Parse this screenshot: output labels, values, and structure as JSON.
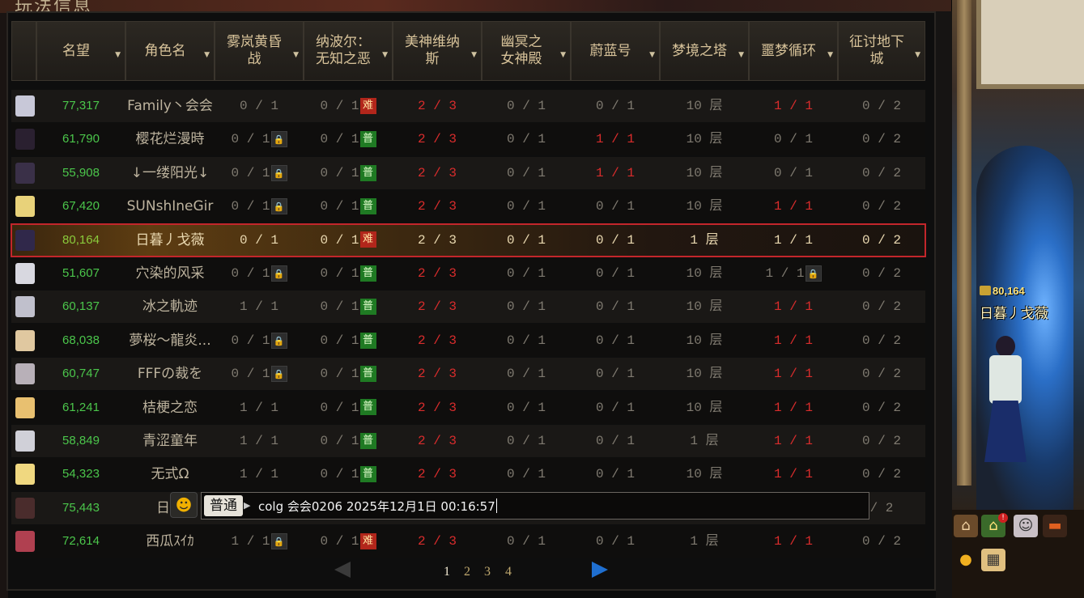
{
  "page_title_fragment": "玩法信息",
  "columns": [
    {
      "label": "",
      "sortable": false
    },
    {
      "label": "名望",
      "sortable": true
    },
    {
      "label": "角色名",
      "sortable": true
    },
    {
      "label": "雾岚黄昏\n战",
      "sortable": true
    },
    {
      "label": "纳波尔：\n无知之恶",
      "sortable": true
    },
    {
      "label": "美神维纳\n斯",
      "sortable": true
    },
    {
      "label": "幽冥之\n女神殿",
      "sortable": true
    },
    {
      "label": "蔚蓝号",
      "sortable": true
    },
    {
      "label": "梦境之塔",
      "sortable": true
    },
    {
      "label": "噩梦循环",
      "sortable": true
    },
    {
      "label": "征讨地下\n城",
      "sortable": true
    }
  ],
  "rows": [
    {
      "fame": "77,317",
      "name": "Family丶会会",
      "wulan": "0 / 1",
      "wulan_lock": false,
      "nabor": "0 / 1",
      "nabor_tag": "难",
      "venus": "2 / 3",
      "youming": "0 / 1",
      "weilan": "0 / 1",
      "tower": "10 层",
      "nightmare": "1 / 1",
      "nightmare_lock": false,
      "zhengtao": "0 / 2",
      "avatar_color": "#c8c8d8"
    },
    {
      "fame": "61,790",
      "name": "樱花烂漫時",
      "wulan": "0 / 1",
      "wulan_lock": true,
      "nabor": "0 / 1",
      "nabor_tag": "普",
      "venus": "2 / 3",
      "youming": "0 / 1",
      "weilan": "1 / 1",
      "tower": "10 层",
      "nightmare": "0 / 1",
      "nightmare_lock": false,
      "zhengtao": "0 / 2",
      "avatar_color": "#2a2030"
    },
    {
      "fame": "55,908",
      "name": "↓一缕阳光↓",
      "wulan": "0 / 1",
      "wulan_lock": true,
      "nabor": "0 / 1",
      "nabor_tag": "普",
      "venus": "2 / 3",
      "youming": "0 / 1",
      "weilan": "1 / 1",
      "tower": "10 层",
      "nightmare": "0 / 1",
      "nightmare_lock": false,
      "zhengtao": "0 / 2",
      "avatar_color": "#3a3048"
    },
    {
      "fame": "67,420",
      "name": "SUNshIneGir",
      "wulan": "0 / 1",
      "wulan_lock": true,
      "nabor": "0 / 1",
      "nabor_tag": "普",
      "venus": "2 / 3",
      "youming": "0 / 1",
      "weilan": "0 / 1",
      "tower": "10 层",
      "nightmare": "1 / 1",
      "nightmare_lock": false,
      "zhengtao": "0 / 2",
      "avatar_color": "#e8d27a"
    },
    {
      "fame": "80,164",
      "name": "日暮丿戈薇",
      "wulan": "0 / 1",
      "wulan_lock": false,
      "nabor": "0 / 1",
      "nabor_tag": "难",
      "venus": "2 / 3",
      "youming": "0 / 1",
      "weilan": "0 / 1",
      "tower": "1 层",
      "nightmare": "1 / 1",
      "nightmare_lock": false,
      "zhengtao": "0 / 2",
      "avatar_color": "#30284a",
      "selected": true
    },
    {
      "fame": "51,607",
      "name": "穴染的风采",
      "wulan": "0 / 1",
      "wulan_lock": true,
      "nabor": "0 / 1",
      "nabor_tag": "普",
      "venus": "2 / 3",
      "youming": "0 / 1",
      "weilan": "0 / 1",
      "tower": "10 层",
      "nightmare": "1 / 1",
      "nightmare_lock": true,
      "zhengtao": "0 / 2",
      "avatar_color": "#d8d8e0"
    },
    {
      "fame": "60,137",
      "name": "冰之軌迹",
      "wulan": "1 / 1",
      "wulan_lock": false,
      "nabor": "0 / 1",
      "nabor_tag": "普",
      "venus": "2 / 3",
      "youming": "0 / 1",
      "weilan": "0 / 1",
      "tower": "10 层",
      "nightmare": "1 / 1",
      "nightmare_lock": false,
      "zhengtao": "0 / 2",
      "avatar_color": "#c0c0cc"
    },
    {
      "fame": "68,038",
      "name": "夢桜～龍炎...",
      "wulan": "0 / 1",
      "wulan_lock": true,
      "nabor": "0 / 1",
      "nabor_tag": "普",
      "venus": "2 / 3",
      "youming": "0 / 1",
      "weilan": "0 / 1",
      "tower": "10 层",
      "nightmare": "1 / 1",
      "nightmare_lock": false,
      "zhengtao": "0 / 2",
      "avatar_color": "#e0c8a0"
    },
    {
      "fame": "60,747",
      "name": "FFFの裁を",
      "wulan": "0 / 1",
      "wulan_lock": true,
      "nabor": "0 / 1",
      "nabor_tag": "普",
      "venus": "2 / 3",
      "youming": "0 / 1",
      "weilan": "0 / 1",
      "tower": "10 层",
      "nightmare": "1 / 1",
      "nightmare_lock": false,
      "zhengtao": "0 / 2",
      "avatar_color": "#b8b0b8"
    },
    {
      "fame": "61,241",
      "name": "桔梗之恋",
      "wulan": "1 / 1",
      "wulan_lock": false,
      "nabor": "0 / 1",
      "nabor_tag": "普",
      "venus": "2 / 3",
      "youming": "0 / 1",
      "weilan": "0 / 1",
      "tower": "10 层",
      "nightmare": "1 / 1",
      "nightmare_lock": false,
      "zhengtao": "0 / 2",
      "avatar_color": "#e8c070"
    },
    {
      "fame": "58,849",
      "name": "青涩童年",
      "wulan": "1 / 1",
      "wulan_lock": false,
      "nabor": "0 / 1",
      "nabor_tag": "普",
      "venus": "2 / 3",
      "youming": "0 / 1",
      "weilan": "0 / 1",
      "tower": "1 层",
      "nightmare": "1 / 1",
      "nightmare_lock": false,
      "zhengtao": "0 / 2",
      "avatar_color": "#d0d0d8"
    },
    {
      "fame": "54,323",
      "name": "无式Ω",
      "wulan": "1 / 1",
      "wulan_lock": false,
      "nabor": "0 / 1",
      "nabor_tag": "普",
      "venus": "2 / 3",
      "youming": "0 / 1",
      "weilan": "0 / 1",
      "tower": "10 层",
      "nightmare": "1 / 1",
      "nightmare_lock": false,
      "zhengtao": "0 / 2",
      "avatar_color": "#f0d880"
    },
    {
      "fame": "75,443",
      "name": "日濡",
      "wulan": "",
      "wulan_lock": false,
      "nabor": "",
      "nabor_tag": "",
      "venus": "",
      "youming": "",
      "weilan": "",
      "tower": "",
      "nightmare": "",
      "nightmare_lock": false,
      "zhengtao": "/ 2",
      "avatar_color": "#4a2c2c"
    },
    {
      "fame": "72,614",
      "name": "西瓜ｽｲｶ",
      "wulan": "1 / 1",
      "wulan_lock": true,
      "nabor": "0 / 1",
      "nabor_tag": "难",
      "venus": "2 / 3",
      "youming": "0 / 1",
      "weilan": "0 / 1",
      "tower": "1 层",
      "nightmare": "1 / 1",
      "nightmare_lock": false,
      "zhengtao": "0 / 2",
      "avatar_color": "#b04050"
    }
  ],
  "chat": {
    "channel": "普通",
    "message": "colg 会会0206 2025年12月1日 00:16:57"
  },
  "pager": {
    "pages": [
      "1",
      "2",
      "3",
      "4"
    ],
    "current": "1"
  },
  "scene": {
    "char_fame": "80,164",
    "char_name": "日暮丿戈薇",
    "notification_badge": "!"
  },
  "colors": {
    "fame_green": "#4bc64b",
    "clear_red": "#d82c2c",
    "selected_outline": "#c3262b",
    "hard_tag": "#b2261b",
    "normal_tag": "#1f7a23",
    "header_text": "#d8c39a"
  }
}
